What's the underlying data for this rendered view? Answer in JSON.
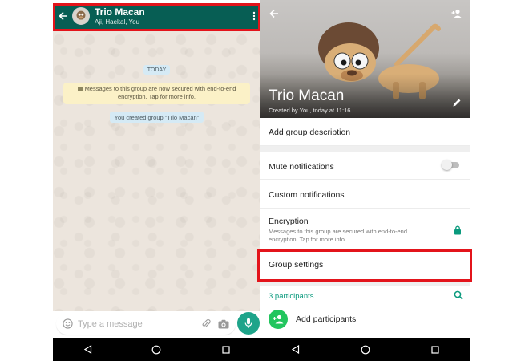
{
  "colors": {
    "header_green": "#075e54",
    "accent_teal": "#0a9a7d",
    "mic_green": "#1ea48a",
    "add_green": "#22c55e",
    "highlight_red": "#e3141b",
    "chat_bg": "#ece5dd",
    "system_note": "#fbf1c7",
    "date_chip": "#d5eaf5"
  },
  "chat": {
    "header": {
      "title": "Trio Macan",
      "subtitle": "Aji, Haekal, You",
      "back_icon": "arrow-left-icon",
      "more_icon": "more-vertical-icon"
    },
    "date_chip": "TODAY",
    "security_note": "Messages to this group are now secured with end-to-end encryption. Tap for more info.",
    "created_note": "You created group \"Trio Macan\"",
    "input": {
      "placeholder": "Type a message",
      "emoji_icon": "emoji-icon",
      "attach_icon": "paperclip-icon",
      "camera_icon": "camera-icon",
      "mic_icon": "microphone-icon"
    }
  },
  "group_info": {
    "name": "Trio Macan",
    "created": "Created by You, today at 11:16",
    "add_description": "Add group description",
    "mute_notifications": "Mute notifications",
    "mute_enabled": false,
    "custom_notifications": "Custom notifications",
    "encryption_title": "Encryption",
    "encryption_sub": "Messages to this group are secured with end-to-end encryption. Tap for more info.",
    "group_settings": "Group settings",
    "participants_count": "3 participants",
    "add_participants": "Add participants"
  },
  "nav": {
    "back_icon": "nav-back-triangle-icon",
    "home_icon": "nav-home-circle-icon",
    "recents_icon": "nav-recents-square-icon"
  }
}
